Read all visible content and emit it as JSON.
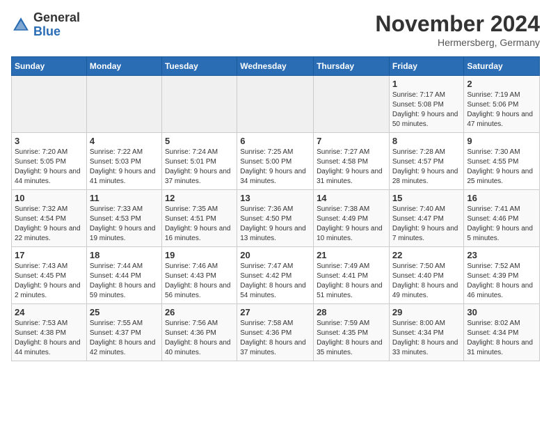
{
  "header": {
    "logo_general": "General",
    "logo_blue": "Blue",
    "month_title": "November 2024",
    "location": "Hermersberg, Germany"
  },
  "weekdays": [
    "Sunday",
    "Monday",
    "Tuesday",
    "Wednesday",
    "Thursday",
    "Friday",
    "Saturday"
  ],
  "weeks": [
    [
      {
        "day": "",
        "info": ""
      },
      {
        "day": "",
        "info": ""
      },
      {
        "day": "",
        "info": ""
      },
      {
        "day": "",
        "info": ""
      },
      {
        "day": "",
        "info": ""
      },
      {
        "day": "1",
        "info": "Sunrise: 7:17 AM\nSunset: 5:08 PM\nDaylight: 9 hours and 50 minutes."
      },
      {
        "day": "2",
        "info": "Sunrise: 7:19 AM\nSunset: 5:06 PM\nDaylight: 9 hours and 47 minutes."
      }
    ],
    [
      {
        "day": "3",
        "info": "Sunrise: 7:20 AM\nSunset: 5:05 PM\nDaylight: 9 hours and 44 minutes."
      },
      {
        "day": "4",
        "info": "Sunrise: 7:22 AM\nSunset: 5:03 PM\nDaylight: 9 hours and 41 minutes."
      },
      {
        "day": "5",
        "info": "Sunrise: 7:24 AM\nSunset: 5:01 PM\nDaylight: 9 hours and 37 minutes."
      },
      {
        "day": "6",
        "info": "Sunrise: 7:25 AM\nSunset: 5:00 PM\nDaylight: 9 hours and 34 minutes."
      },
      {
        "day": "7",
        "info": "Sunrise: 7:27 AM\nSunset: 4:58 PM\nDaylight: 9 hours and 31 minutes."
      },
      {
        "day": "8",
        "info": "Sunrise: 7:28 AM\nSunset: 4:57 PM\nDaylight: 9 hours and 28 minutes."
      },
      {
        "day": "9",
        "info": "Sunrise: 7:30 AM\nSunset: 4:55 PM\nDaylight: 9 hours and 25 minutes."
      }
    ],
    [
      {
        "day": "10",
        "info": "Sunrise: 7:32 AM\nSunset: 4:54 PM\nDaylight: 9 hours and 22 minutes."
      },
      {
        "day": "11",
        "info": "Sunrise: 7:33 AM\nSunset: 4:53 PM\nDaylight: 9 hours and 19 minutes."
      },
      {
        "day": "12",
        "info": "Sunrise: 7:35 AM\nSunset: 4:51 PM\nDaylight: 9 hours and 16 minutes."
      },
      {
        "day": "13",
        "info": "Sunrise: 7:36 AM\nSunset: 4:50 PM\nDaylight: 9 hours and 13 minutes."
      },
      {
        "day": "14",
        "info": "Sunrise: 7:38 AM\nSunset: 4:49 PM\nDaylight: 9 hours and 10 minutes."
      },
      {
        "day": "15",
        "info": "Sunrise: 7:40 AM\nSunset: 4:47 PM\nDaylight: 9 hours and 7 minutes."
      },
      {
        "day": "16",
        "info": "Sunrise: 7:41 AM\nSunset: 4:46 PM\nDaylight: 9 hours and 5 minutes."
      }
    ],
    [
      {
        "day": "17",
        "info": "Sunrise: 7:43 AM\nSunset: 4:45 PM\nDaylight: 9 hours and 2 minutes."
      },
      {
        "day": "18",
        "info": "Sunrise: 7:44 AM\nSunset: 4:44 PM\nDaylight: 8 hours and 59 minutes."
      },
      {
        "day": "19",
        "info": "Sunrise: 7:46 AM\nSunset: 4:43 PM\nDaylight: 8 hours and 56 minutes."
      },
      {
        "day": "20",
        "info": "Sunrise: 7:47 AM\nSunset: 4:42 PM\nDaylight: 8 hours and 54 minutes."
      },
      {
        "day": "21",
        "info": "Sunrise: 7:49 AM\nSunset: 4:41 PM\nDaylight: 8 hours and 51 minutes."
      },
      {
        "day": "22",
        "info": "Sunrise: 7:50 AM\nSunset: 4:40 PM\nDaylight: 8 hours and 49 minutes."
      },
      {
        "day": "23",
        "info": "Sunrise: 7:52 AM\nSunset: 4:39 PM\nDaylight: 8 hours and 46 minutes."
      }
    ],
    [
      {
        "day": "24",
        "info": "Sunrise: 7:53 AM\nSunset: 4:38 PM\nDaylight: 8 hours and 44 minutes."
      },
      {
        "day": "25",
        "info": "Sunrise: 7:55 AM\nSunset: 4:37 PM\nDaylight: 8 hours and 42 minutes."
      },
      {
        "day": "26",
        "info": "Sunrise: 7:56 AM\nSunset: 4:36 PM\nDaylight: 8 hours and 40 minutes."
      },
      {
        "day": "27",
        "info": "Sunrise: 7:58 AM\nSunset: 4:36 PM\nDaylight: 8 hours and 37 minutes."
      },
      {
        "day": "28",
        "info": "Sunrise: 7:59 AM\nSunset: 4:35 PM\nDaylight: 8 hours and 35 minutes."
      },
      {
        "day": "29",
        "info": "Sunrise: 8:00 AM\nSunset: 4:34 PM\nDaylight: 8 hours and 33 minutes."
      },
      {
        "day": "30",
        "info": "Sunrise: 8:02 AM\nSunset: 4:34 PM\nDaylight: 8 hours and 31 minutes."
      }
    ]
  ]
}
